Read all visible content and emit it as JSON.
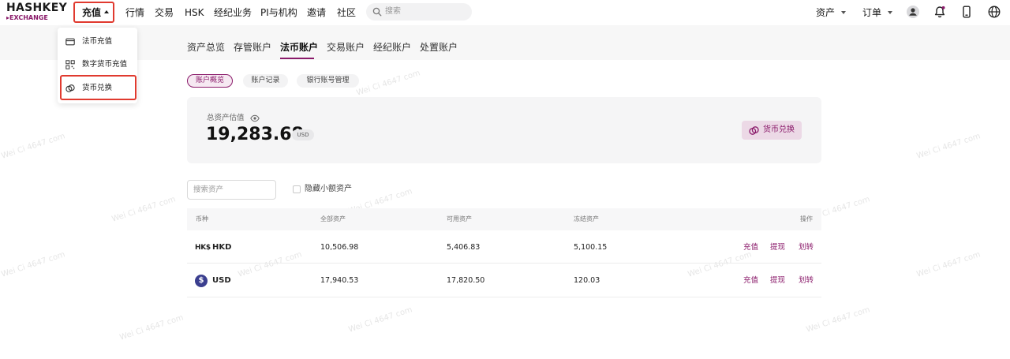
{
  "brand": {
    "name": "HASHKEY",
    "sub": "▸EXCHANGE"
  },
  "topnav": {
    "deposit": "充值",
    "items": [
      "行情",
      "交易",
      "HSK",
      "经纪业务",
      "PI与机构",
      "邀请",
      "社区"
    ],
    "search_placeholder": "搜索",
    "assets": "资产",
    "orders": "订单"
  },
  "dropdown": {
    "items": [
      {
        "label": "法币充值",
        "icon": "card-icon"
      },
      {
        "label": "数字货币充值",
        "icon": "qr-icon"
      },
      {
        "label": "货币兑换",
        "icon": "exchange-icon"
      }
    ]
  },
  "tabs": [
    "资产总览",
    "存管账户",
    "法币账户",
    "交易账户",
    "经纪账户",
    "处置账户"
  ],
  "active_tab": "法币账户",
  "subtabs": [
    "账户概览",
    "账户记录",
    "银行账号管理"
  ],
  "summary": {
    "label": "总资产估值",
    "value": "19,283.68",
    "currency": "USD",
    "convert_button": "货币兑换"
  },
  "filters": {
    "search_placeholder": "搜索资产",
    "hide_small": "隐藏小额资产"
  },
  "table": {
    "headers": [
      "币种",
      "全部资产",
      "可用资产",
      "冻结资产",
      "操作"
    ],
    "rows": [
      {
        "symbol": "HK$",
        "currency": "HKD",
        "total": "10,506.98",
        "available": "5,406.83",
        "frozen": "5,100.15"
      },
      {
        "symbol": "$",
        "currency": "USD",
        "total": "17,940.53",
        "available": "17,820.50",
        "frozen": "120.03"
      }
    ],
    "actions": [
      "充值",
      "提现",
      "划转"
    ]
  },
  "watermark": "Wei Ci 4647 com",
  "colors": {
    "brand": "#8a1a6a",
    "highlight": "#e03a2f",
    "usd_badge": "#3b3f8f"
  }
}
